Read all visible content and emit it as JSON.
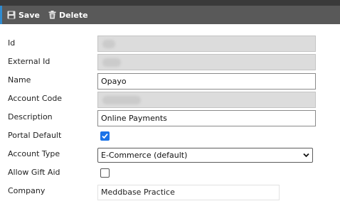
{
  "toolbar": {
    "save_label": "Save",
    "delete_label": "Delete",
    "save_icon": "floppy-disk-icon",
    "delete_icon": "trash-icon",
    "accent_color": "#2f8bd0",
    "background_color": "#595959"
  },
  "form": {
    "id": {
      "label": "Id",
      "value": ""
    },
    "external_id": {
      "label": "External Id",
      "value": ""
    },
    "name": {
      "label": "Name",
      "value": "Opayo"
    },
    "account_code": {
      "label": "Account Code",
      "value": ""
    },
    "description": {
      "label": "Description",
      "value": "Online Payments"
    },
    "portal_default": {
      "label": "Portal Default",
      "checked": true
    },
    "account_type": {
      "label": "Account Type",
      "value": "E-Commerce (default)"
    },
    "allow_gift_aid": {
      "label": "Allow Gift Aid",
      "checked": false
    },
    "company": {
      "label": "Company",
      "value": "Meddbase Practice"
    }
  }
}
